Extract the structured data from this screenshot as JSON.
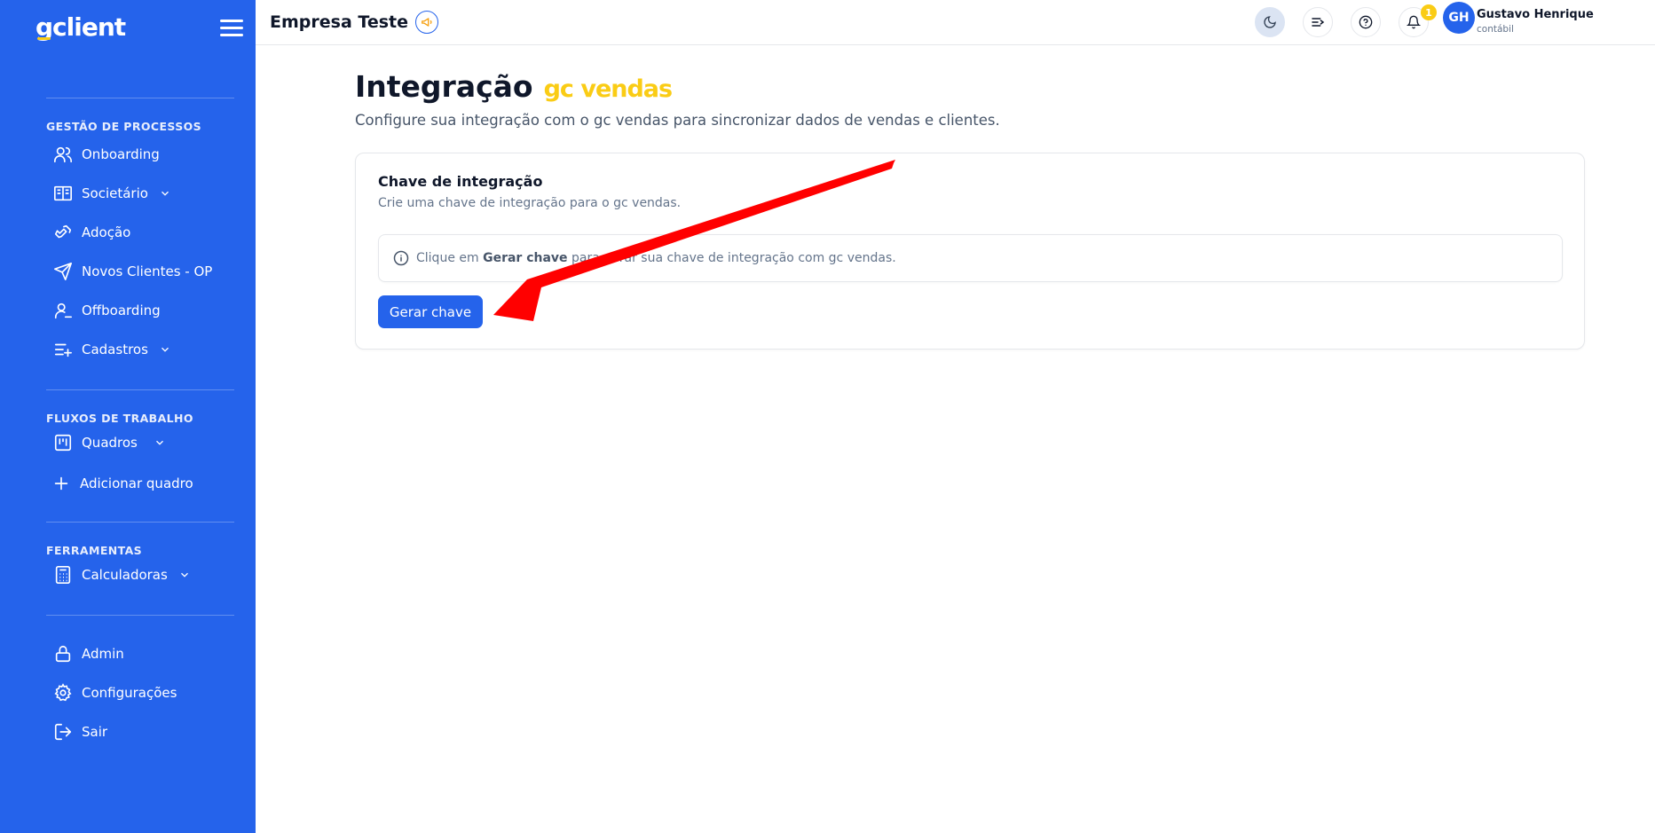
{
  "brand": {
    "logo_g": "g",
    "logo_rest": "client"
  },
  "sidebar": {
    "sections": [
      {
        "title": "GESTÃO DE PROCESSOS"
      },
      {
        "title": "FLUXOS DE TRABALHO"
      },
      {
        "title": "FERRAMENTAS"
      }
    ],
    "items": [
      {
        "label": "Onboarding",
        "icon": "users-icon"
      },
      {
        "label": "Societário",
        "icon": "book-icon"
      },
      {
        "label": "Adoção",
        "icon": "handshake-icon"
      },
      {
        "label": "Novos Clientes - OP",
        "icon": "send-icon"
      },
      {
        "label": "Offboarding",
        "icon": "user-minus-icon"
      },
      {
        "label": "Cadastros",
        "icon": "list-plus-icon"
      },
      {
        "label": "Quadros",
        "icon": "kanban-icon"
      },
      {
        "label": "Adicionar quadro",
        "icon": "plus-icon"
      },
      {
        "label": "Calculadoras",
        "icon": "calculator-icon"
      },
      {
        "label": "Admin",
        "icon": "lock-icon"
      },
      {
        "label": "Configurações",
        "icon": "gear-icon"
      },
      {
        "label": "Sair",
        "icon": "logout-icon"
      }
    ]
  },
  "topbar": {
    "company": "Empresa Teste",
    "notification_count": "1",
    "user": {
      "initials": "GH",
      "name": "Gustavo Henrique",
      "role": "contábil"
    }
  },
  "main": {
    "title": "Integração",
    "brand_word": "gc vendas",
    "subtitle": "Configure sua integração com o gc vendas para sincronizar dados de vendas e clientes.",
    "card": {
      "title": "Chave de integração",
      "subtitle": "Crie uma chave de integração para o gc vendas.",
      "info_prefix": "Clique em",
      "info_bold": "Gerar chave",
      "info_suffix": "para gerar sua chave de integração com gc vendas.",
      "button": "Gerar chave"
    }
  },
  "colors": {
    "sidebar": "#2563eb",
    "accent": "#facc15",
    "arrow": "#ff0000"
  }
}
